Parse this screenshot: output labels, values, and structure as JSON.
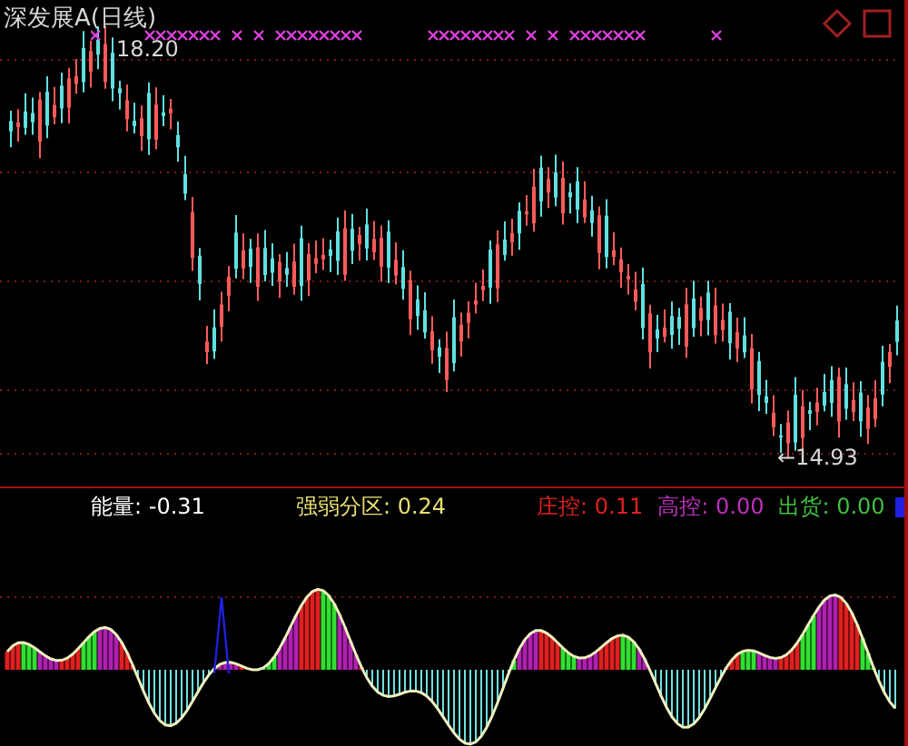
{
  "title": "深发展A(日线)",
  "price_chart": {
    "high_label": "18.20",
    "low_label": "←14.93"
  },
  "indicators": [
    {
      "label": "能量:",
      "value": "-0.31",
      "color": "#ffffff"
    },
    {
      "label": "强弱分区:",
      "value": "0.24",
      "color": "#e8e070"
    },
    {
      "label": "庄控:",
      "value": "0.11",
      "color": "#e02020"
    },
    {
      "label": "高控:",
      "value": "0.00",
      "color": "#c030c0"
    },
    {
      "label": "出货:",
      "value": "0.00",
      "color": "#40c040"
    }
  ],
  "legend_swatch": {
    "color": "#2020e0"
  }
}
